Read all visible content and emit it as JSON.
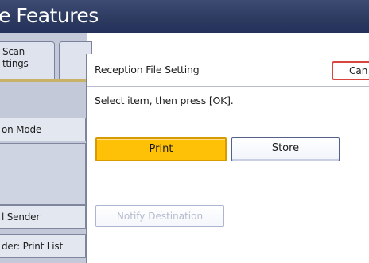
{
  "header": {
    "title": "e Features"
  },
  "sidebar": {
    "tab_scan_label": "Scan\nttings",
    "mode_label": "on Mode",
    "sender_label": "l Sender",
    "printlist_label": "der: Print List"
  },
  "dialog": {
    "title": "Reception File Setting",
    "cancel_label": "Can",
    "instruction": "Select item, then press [OK].",
    "options": [
      {
        "label": "Print",
        "selected": true
      },
      {
        "label": "Store",
        "selected": false
      }
    ],
    "notify_label": "Notify Destination",
    "notify_enabled": false
  },
  "colors": {
    "header_bg": "#2c3a60",
    "selected_button": "#ffc107",
    "cancel_border": "#d8453c"
  }
}
